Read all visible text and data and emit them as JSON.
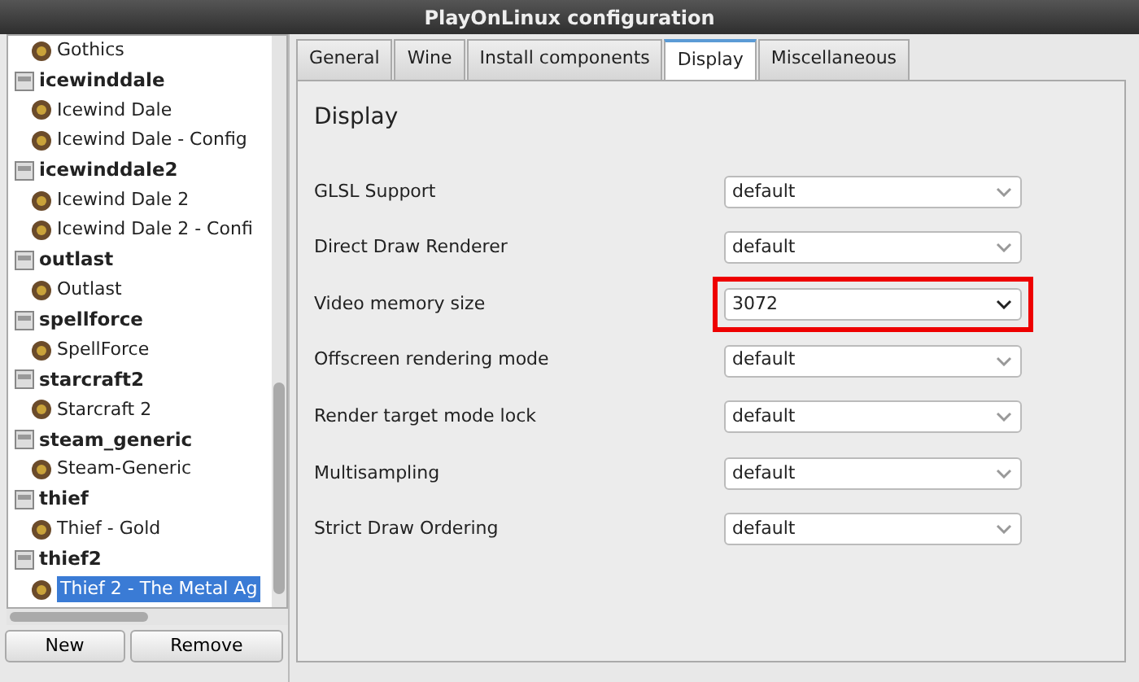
{
  "window": {
    "title": "PlayOnLinux configuration"
  },
  "sidebar": {
    "items": [
      {
        "label": "Gothics",
        "kind": "app",
        "selected": false
      },
      {
        "label": "icewinddale",
        "kind": "prefix",
        "selected": false
      },
      {
        "label": "Icewind Dale",
        "kind": "app",
        "selected": false
      },
      {
        "label": "Icewind Dale - Config",
        "kind": "app",
        "selected": false
      },
      {
        "label": "icewinddale2",
        "kind": "prefix",
        "selected": false
      },
      {
        "label": "Icewind Dale 2",
        "kind": "app",
        "selected": false
      },
      {
        "label": "Icewind Dale 2 - Confi",
        "kind": "app",
        "selected": false
      },
      {
        "label": "outlast",
        "kind": "prefix",
        "selected": false
      },
      {
        "label": "Outlast",
        "kind": "app",
        "selected": false
      },
      {
        "label": "spellforce",
        "kind": "prefix",
        "selected": false
      },
      {
        "label": "SpellForce",
        "kind": "app",
        "selected": false
      },
      {
        "label": "starcraft2",
        "kind": "prefix",
        "selected": false
      },
      {
        "label": "Starcraft 2",
        "kind": "app",
        "selected": false
      },
      {
        "label": "steam_generic",
        "kind": "prefix",
        "selected": false
      },
      {
        "label": "Steam-Generic",
        "kind": "app",
        "selected": false
      },
      {
        "label": "thief",
        "kind": "prefix",
        "selected": false
      },
      {
        "label": "Thief - Gold",
        "kind": "app",
        "selected": false
      },
      {
        "label": "thief2",
        "kind": "prefix",
        "selected": false
      },
      {
        "label": "Thief 2 - The Metal Ag",
        "kind": "app",
        "selected": true
      }
    ],
    "buttons": [
      "New",
      "Remove"
    ]
  },
  "tabs": [
    {
      "label": "General",
      "selected": false
    },
    {
      "label": "Wine",
      "selected": false
    },
    {
      "label": "Install components",
      "selected": false
    },
    {
      "label": "Display",
      "selected": true
    },
    {
      "label": "Miscellaneous",
      "selected": false
    }
  ],
  "panel": {
    "heading": "Display",
    "settings": [
      {
        "label": "GLSL Support",
        "value": "default",
        "highlighted": false
      },
      {
        "label": "Direct Draw Renderer",
        "value": "default",
        "highlighted": false
      },
      {
        "label": "Video memory size",
        "value": "3072",
        "highlighted": true
      },
      {
        "label": "Offscreen rendering mode",
        "value": "default",
        "highlighted": false
      },
      {
        "label": "Render target mode lock",
        "value": "default",
        "highlighted": false
      },
      {
        "label": "Multisampling",
        "value": "default",
        "highlighted": false
      },
      {
        "label": "Strict Draw Ordering",
        "value": "default",
        "highlighted": false
      }
    ]
  }
}
